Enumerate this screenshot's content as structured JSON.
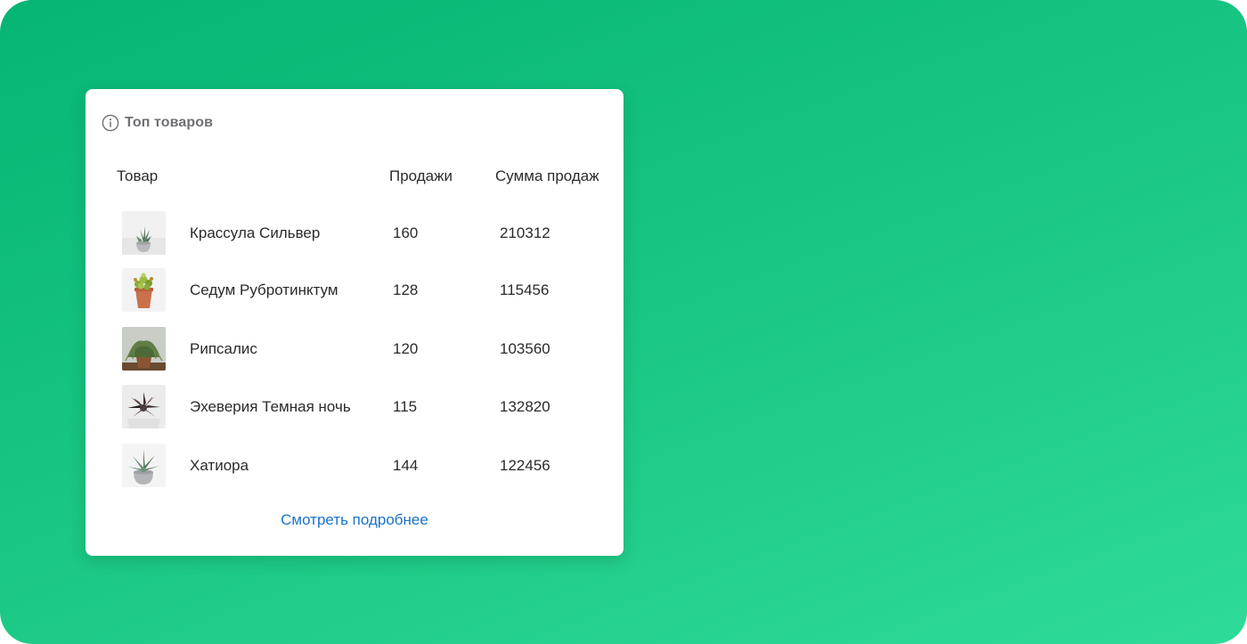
{
  "widget": {
    "title": "Топ товаров",
    "info_icon": "info-circle-icon",
    "columns": {
      "product": "Товар",
      "sales": "Продажи",
      "sum": "Сумма продаж"
    },
    "rows": [
      {
        "name": "Крассула Сильвер",
        "sales": "160",
        "sum": "210312",
        "thumbnail": "succulent-grey-pot"
      },
      {
        "name": "Седум Рубротинктум",
        "sales": "128",
        "sum": "115456",
        "thumbnail": "sedum-terracotta-pot"
      },
      {
        "name": "Рипсалис",
        "sales": "120",
        "sum": "103560",
        "thumbnail": "rhipsalis-pot"
      },
      {
        "name": "Эхеверия Темная ночь",
        "sales": "115",
        "sum": "132820",
        "thumbnail": "echeveria-dark"
      },
      {
        "name": "Хатиора",
        "sales": "144",
        "sum": "122456",
        "thumbnail": "haworthia-grey-pot"
      }
    ],
    "more_link": "Смотреть подробнее"
  },
  "colors": {
    "background_gradient_start": "#06b574",
    "background_gradient_end": "#2fdb98",
    "card": "#ffffff",
    "title": "#6f6f74",
    "text": "#2b2b2e",
    "link": "#1a73c8"
  }
}
